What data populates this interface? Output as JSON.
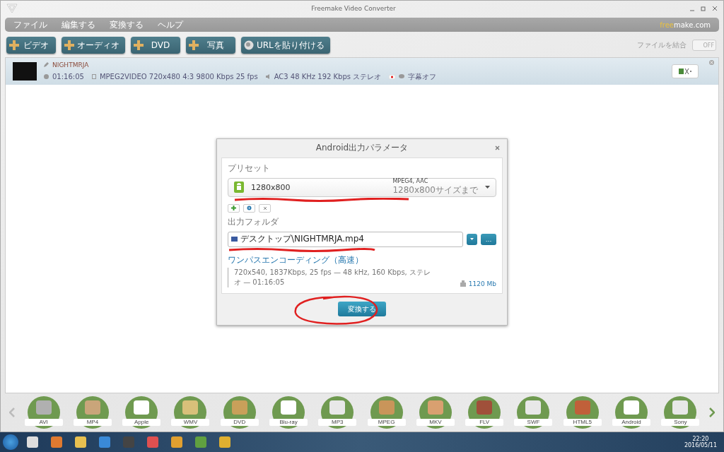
{
  "window": {
    "title": "Freemake Video Converter"
  },
  "menu": {
    "items": [
      "ファイル",
      "編集する",
      "変換する",
      "ヘルプ"
    ],
    "brand_prefix": "free",
    "brand_rest": "make.com"
  },
  "toolbar": {
    "buttons": [
      {
        "label": "ビデオ",
        "kind": "add"
      },
      {
        "label": "オーディオ",
        "kind": "add"
      },
      {
        "label": "DVD",
        "kind": "add"
      },
      {
        "label": "写真",
        "kind": "add"
      },
      {
        "label": "URLを貼り付ける",
        "kind": "url"
      }
    ],
    "merge": {
      "label": "ファイルを結合",
      "toggle": "OFF",
      "on": false
    }
  },
  "file": {
    "name": "NIGHTMRJA",
    "duration": "01:16:05",
    "video": "MPEG2VIDEO  720x480  4:3  9800 Kbps  25 fps",
    "audio": "AC3  48 KHz  192 Kbps  ステレオ",
    "subtitles": "字幕オフ"
  },
  "dialog": {
    "title": "Android出力パラメータ",
    "preset_label": "プリセット",
    "preset": "1280x800",
    "codec": "MPEG4, AAC",
    "preset_note": "1280x800サイズまで",
    "folder_label": "出力フォルダ",
    "path": "デスクトップ\\NIGHTMRJA.mp4",
    "browse": "...",
    "encoding": "ワンパスエンコーディング（高速）",
    "details": "720x540, 1837Kbps, 25 fps — 48 kHz, 160 Kbps, ステレオ — 01:16:05",
    "size": "1120 Mb",
    "convert": "変換する"
  },
  "formats": [
    {
      "label": "AVI",
      "color": "#b0b0b0"
    },
    {
      "label": "MP4",
      "color": "#c9a57a"
    },
    {
      "label": "Apple",
      "color": "#ffffff"
    },
    {
      "label": "WMV",
      "color": "#d8c07a"
    },
    {
      "label": "DVD",
      "color": "#c9a05a"
    },
    {
      "label": "Blu-ray",
      "color": "#ffffff"
    },
    {
      "label": "MP3",
      "color": "#e8e8e8"
    },
    {
      "label": "MPEG",
      "color": "#c9955a"
    },
    {
      "label": "MKV",
      "color": "#d9a070"
    },
    {
      "label": "FLV",
      "color": "#a0503a"
    },
    {
      "label": "SWF",
      "color": "#e8e8e8"
    },
    {
      "label": "HTML5",
      "color": "#c0603a"
    },
    {
      "label": "Android",
      "color": "#ffffff"
    },
    {
      "label": "Sony",
      "color": "#e8e8e8"
    }
  ],
  "taskbar": {
    "time": "22:20",
    "date": "2016/05/11"
  }
}
